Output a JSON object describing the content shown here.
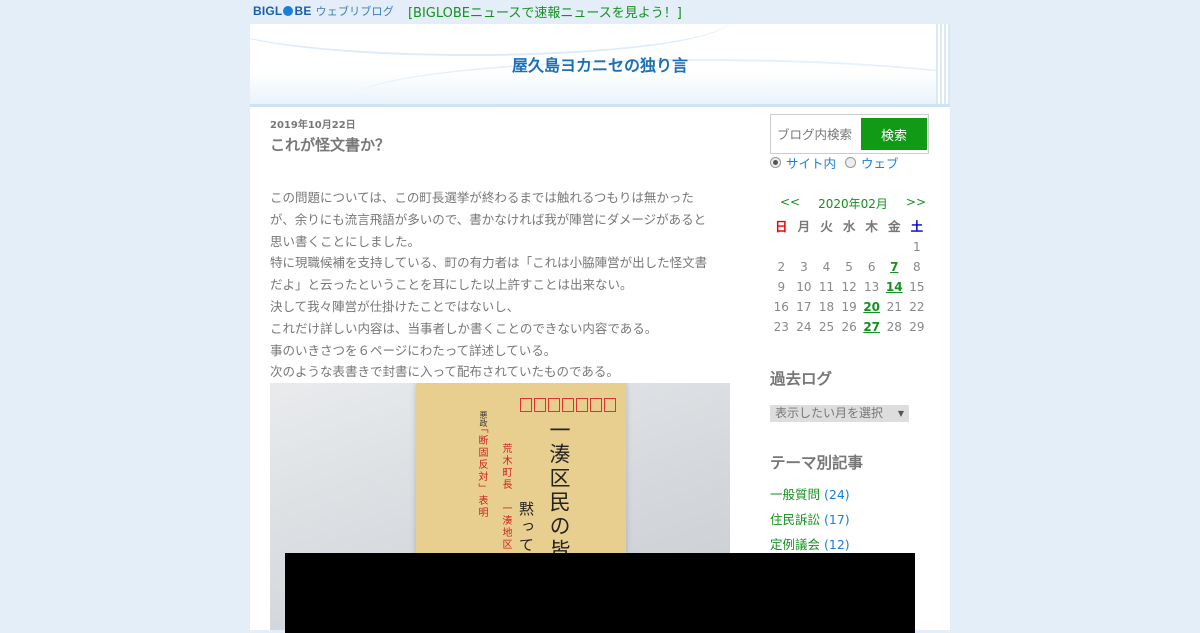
{
  "topbar": {
    "logo_main": "BIGL",
    "logo_end": "BE",
    "logo_sub": "ウェブリブログ",
    "news_link": "[BIGLOBEニュースで速報ニュースを見よう！]"
  },
  "blog": {
    "title": "屋久島ヨカニセの独り言"
  },
  "post": {
    "date": "2019年10月22日",
    "title": "これが怪文書か？",
    "lines": [
      "この問題については、この町長選挙が終わるまでは触れるつもりは無かった",
      "が、余りにも流言飛語が多いので、書かなければ我が陣営にダメージがあると",
      "思い書くことにしました。",
      "特に現職候補を支持している、町の有力者は「これは小脇陣営が出した怪文書",
      "だよ」と云ったということを耳にした以上許すことは出来ない。",
      "決して我々陣営が仕掛けたことではないし、",
      "これだけ詳しい内容は、当事者しか書くことのできない内容である。",
      "事のいきさつを６ページにわたって詳述している。",
      "次のような表書きで封書に入って配布されていたものである。"
    ],
    "envelope": {
      "main": "一湊区民の皆様へ",
      "main2": "黙っては",
      "red1": "荒木町長　一湊地区",
      "red2": "「断固反対」表明",
      "black_small": "悪政"
    }
  },
  "search": {
    "placeholder": "ブログ内検索",
    "button": "検索",
    "opt_site": "サイト内",
    "opt_web": "ウェブ"
  },
  "calendar": {
    "prev": "<<",
    "month": "2020年02月",
    "next": ">>",
    "dows": [
      "日",
      "月",
      "火",
      "水",
      "木",
      "金",
      "土"
    ],
    "rows": [
      [
        "",
        "",
        "",
        "",
        "",
        "",
        "1"
      ],
      [
        "2",
        "3",
        "4",
        "5",
        "6",
        "7",
        "8"
      ],
      [
        "9",
        "10",
        "11",
        "12",
        "13",
        "14",
        "15"
      ],
      [
        "16",
        "17",
        "18",
        "19",
        "20",
        "21",
        "22"
      ],
      [
        "23",
        "24",
        "25",
        "26",
        "27",
        "28",
        "29"
      ]
    ],
    "linked": [
      "7",
      "14",
      "20",
      "27"
    ]
  },
  "archive": {
    "heading": "過去ログ",
    "select_label": "表示したい月を選択"
  },
  "themes": {
    "heading": "テーマ別記事",
    "items": [
      {
        "name": "一般質問",
        "count": "(24)"
      },
      {
        "name": "住民訴訟",
        "count": "(17)"
      },
      {
        "name": "定例議会",
        "count": "(12)"
      }
    ]
  }
}
